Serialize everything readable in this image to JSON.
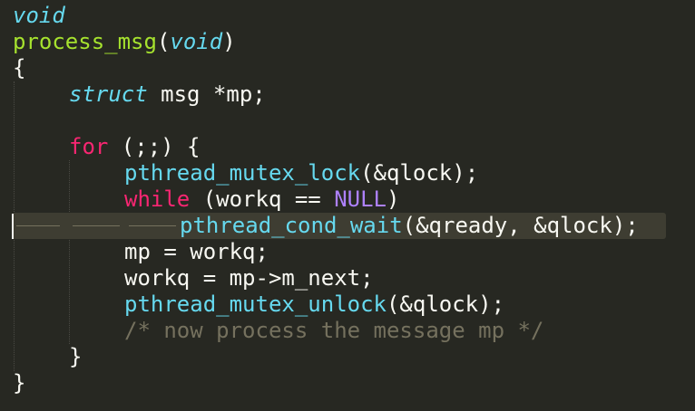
{
  "editor": {
    "colors": {
      "background": "#272822",
      "current_line": "#3e3d32",
      "plain": "#f8f8f2",
      "keyword": "#f92672",
      "type": "#66d9ef",
      "function_name": "#a6e22e",
      "constant": "#ae81ff",
      "comment": "#75715e"
    },
    "lines": {
      "l1": {
        "ret_type": "void"
      },
      "l2": {
        "fn_name": "process_msg",
        "open": "(",
        "param_type": "void",
        "close": ")"
      },
      "l3": {
        "text": "{"
      },
      "l4": {
        "kw": "struct",
        "rest": " msg *mp;"
      },
      "l6": {
        "kw": "for",
        "rest": " (;;) {"
      },
      "l7": {
        "call": "pthread_mutex_lock",
        "rest": "(&qlock);"
      },
      "l8": {
        "kw": "while",
        "mid": " (workq == ",
        "const": "NULL",
        "rest": ")"
      },
      "l9": {
        "call": "pthread_cond_wait",
        "rest": "(&qready, &qlock);"
      },
      "l10": {
        "text": "mp = workq;"
      },
      "l11": {
        "text": "workq = mp->m_next;"
      },
      "l12": {
        "call": "pthread_mutex_unlock",
        "rest": "(&qlock);"
      },
      "l13": {
        "comment": "/* now process the message mp */"
      },
      "l14": {
        "text": "}"
      },
      "l15": {
        "text": "}"
      }
    }
  }
}
